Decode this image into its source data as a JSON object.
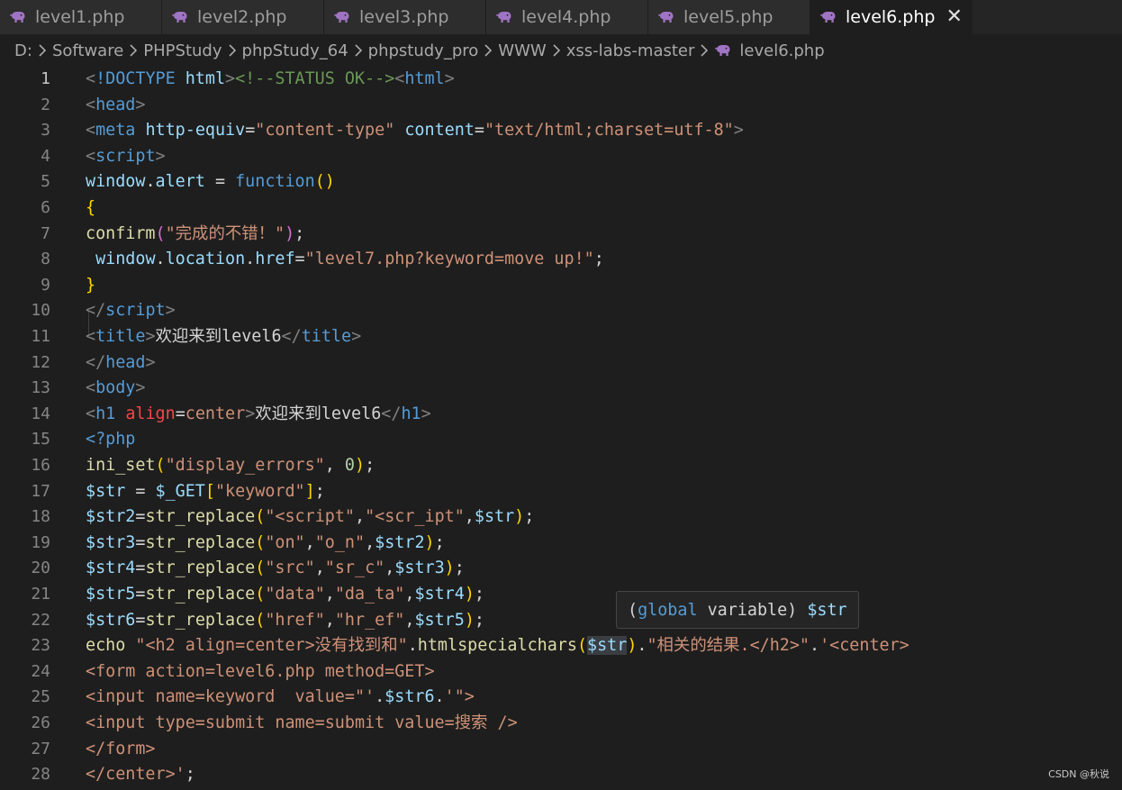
{
  "tabs": [
    {
      "label": "level1.php",
      "active": false
    },
    {
      "label": "level2.php",
      "active": false
    },
    {
      "label": "level3.php",
      "active": false
    },
    {
      "label": "level4.php",
      "active": false
    },
    {
      "label": "level5.php",
      "active": false
    },
    {
      "label": "level6.php",
      "active": true
    }
  ],
  "breadcrumb": {
    "parts": [
      "D:",
      "Software",
      "PHPStudy",
      "phpStudy_64",
      "phpstudy_pro",
      "WWW",
      "xss-labs-master"
    ],
    "file": "level6.php"
  },
  "editor": {
    "current_line": 1,
    "lines": [
      {
        "n": "1",
        "tokens": [
          [
            "t-punc",
            "<"
          ],
          [
            "t-tag",
            "!DOCTYPE"
          ],
          [
            "t-plain",
            " "
          ],
          [
            "t-attr",
            "html"
          ],
          [
            "t-punc",
            ">"
          ],
          [
            "t-cmt",
            "<!--STATUS OK-->"
          ],
          [
            "t-punc",
            "<"
          ],
          [
            "t-tag",
            "html"
          ],
          [
            "t-punc",
            ">"
          ]
        ]
      },
      {
        "n": "2",
        "tokens": [
          [
            "t-punc",
            "<"
          ],
          [
            "t-tag",
            "head"
          ],
          [
            "t-punc",
            ">"
          ]
        ]
      },
      {
        "n": "3",
        "tokens": [
          [
            "t-punc",
            "<"
          ],
          [
            "t-tag",
            "meta"
          ],
          [
            "t-plain",
            " "
          ],
          [
            "t-attr",
            "http-equiv"
          ],
          [
            "t-plain",
            "="
          ],
          [
            "t-str",
            "\"content-type\""
          ],
          [
            "t-plain",
            " "
          ],
          [
            "t-attr",
            "content"
          ],
          [
            "t-plain",
            "="
          ],
          [
            "t-str",
            "\"text/html;charset=utf-8\""
          ],
          [
            "t-punc",
            ">"
          ]
        ]
      },
      {
        "n": "4",
        "tokens": [
          [
            "t-punc",
            "<"
          ],
          [
            "t-tag",
            "script"
          ],
          [
            "t-punc",
            ">"
          ]
        ]
      },
      {
        "n": "5",
        "tokens": [
          [
            "t-var",
            "window"
          ],
          [
            "t-plain",
            "."
          ],
          [
            "t-var",
            "alert"
          ],
          [
            "t-plain",
            " = "
          ],
          [
            "t-kw",
            "function"
          ],
          [
            "t-br1",
            "()"
          ]
        ]
      },
      {
        "n": "6",
        "tokens": [
          [
            "t-br1",
            "{"
          ]
        ]
      },
      {
        "n": "7",
        "tokens": [
          [
            "t-fn",
            "confirm"
          ],
          [
            "t-br2",
            "("
          ],
          [
            "t-str",
            "\"完成的不错！\""
          ],
          [
            "t-br2",
            ")"
          ],
          [
            "t-plain",
            ";"
          ]
        ]
      },
      {
        "n": "8",
        "tokens": [
          [
            "t-plain",
            " "
          ],
          [
            "t-var",
            "window"
          ],
          [
            "t-plain",
            "."
          ],
          [
            "t-var",
            "location"
          ],
          [
            "t-plain",
            "."
          ],
          [
            "t-var",
            "href"
          ],
          [
            "t-plain",
            "="
          ],
          [
            "t-str",
            "\"level7.php?keyword=move up!\""
          ],
          [
            "t-plain",
            ";"
          ]
        ]
      },
      {
        "n": "9",
        "tokens": [
          [
            "t-br1",
            "}"
          ]
        ]
      },
      {
        "n": "10",
        "tokens": [
          [
            "t-punc",
            "</"
          ],
          [
            "t-tag",
            "script"
          ],
          [
            "t-punc",
            ">"
          ]
        ]
      },
      {
        "n": "11",
        "tokens": [
          [
            "t-punc",
            "<"
          ],
          [
            "t-tag",
            "title"
          ],
          [
            "t-punc",
            ">"
          ],
          [
            "t-plain",
            "欢迎来到level6"
          ],
          [
            "t-punc",
            "</"
          ],
          [
            "t-tag",
            "title"
          ],
          [
            "t-punc",
            ">"
          ]
        ]
      },
      {
        "n": "12",
        "tokens": [
          [
            "t-punc",
            "</"
          ],
          [
            "t-tag",
            "head"
          ],
          [
            "t-punc",
            ">"
          ]
        ]
      },
      {
        "n": "13",
        "tokens": [
          [
            "t-punc",
            "<"
          ],
          [
            "t-tag",
            "body"
          ],
          [
            "t-punc",
            ">"
          ]
        ]
      },
      {
        "n": "14",
        "tokens": [
          [
            "t-punc",
            "<"
          ],
          [
            "t-tag",
            "h1"
          ],
          [
            "t-plain",
            " "
          ],
          [
            "t-err",
            "align"
          ],
          [
            "t-plain",
            "="
          ],
          [
            "t-str",
            "center"
          ],
          [
            "t-punc",
            ">"
          ],
          [
            "t-plain",
            "欢迎来到level6"
          ],
          [
            "t-punc",
            "</"
          ],
          [
            "t-tag",
            "h1"
          ],
          [
            "t-punc",
            ">"
          ]
        ]
      },
      {
        "n": "15",
        "tokens": [
          [
            "t-tag",
            "<?php"
          ]
        ]
      },
      {
        "n": "16",
        "tokens": [
          [
            "t-fn",
            "ini_set"
          ],
          [
            "t-br1",
            "("
          ],
          [
            "t-str",
            "\"display_errors\""
          ],
          [
            "t-plain",
            ", "
          ],
          [
            "t-num",
            "0"
          ],
          [
            "t-br1",
            ")"
          ],
          [
            "t-plain",
            ";"
          ]
        ]
      },
      {
        "n": "17",
        "tokens": [
          [
            "t-var",
            "$str"
          ],
          [
            "t-plain",
            " = "
          ],
          [
            "t-var",
            "$_GET"
          ],
          [
            "t-br1",
            "["
          ],
          [
            "t-str",
            "\"keyword\""
          ],
          [
            "t-br1",
            "]"
          ],
          [
            "t-plain",
            ";"
          ]
        ]
      },
      {
        "n": "18",
        "tokens": [
          [
            "t-var",
            "$str2"
          ],
          [
            "t-plain",
            "="
          ],
          [
            "t-fn",
            "str_replace"
          ],
          [
            "t-br1",
            "("
          ],
          [
            "t-str",
            "\"<script\""
          ],
          [
            "t-plain",
            ","
          ],
          [
            "t-str",
            "\"<scr_ipt\""
          ],
          [
            "t-plain",
            ","
          ],
          [
            "t-var",
            "$str"
          ],
          [
            "t-br1",
            ")"
          ],
          [
            "t-plain",
            ";"
          ]
        ]
      },
      {
        "n": "19",
        "tokens": [
          [
            "t-var",
            "$str3"
          ],
          [
            "t-plain",
            "="
          ],
          [
            "t-fn",
            "str_replace"
          ],
          [
            "t-br1",
            "("
          ],
          [
            "t-str",
            "\"on\""
          ],
          [
            "t-plain",
            ","
          ],
          [
            "t-str",
            "\"o_n\""
          ],
          [
            "t-plain",
            ","
          ],
          [
            "t-var",
            "$str2"
          ],
          [
            "t-br1",
            ")"
          ],
          [
            "t-plain",
            ";"
          ]
        ]
      },
      {
        "n": "20",
        "tokens": [
          [
            "t-var",
            "$str4"
          ],
          [
            "t-plain",
            "="
          ],
          [
            "t-fn",
            "str_replace"
          ],
          [
            "t-br1",
            "("
          ],
          [
            "t-str",
            "\"src\""
          ],
          [
            "t-plain",
            ","
          ],
          [
            "t-str",
            "\"sr_c\""
          ],
          [
            "t-plain",
            ","
          ],
          [
            "t-var",
            "$str3"
          ],
          [
            "t-br1",
            ")"
          ],
          [
            "t-plain",
            ";"
          ]
        ]
      },
      {
        "n": "21",
        "tokens": [
          [
            "t-var",
            "$str5"
          ],
          [
            "t-plain",
            "="
          ],
          [
            "t-fn",
            "str_replace"
          ],
          [
            "t-br1",
            "("
          ],
          [
            "t-str",
            "\"data\""
          ],
          [
            "t-plain",
            ","
          ],
          [
            "t-str",
            "\"da_ta\""
          ],
          [
            "t-plain",
            ","
          ],
          [
            "t-var",
            "$str4"
          ],
          [
            "t-br1",
            ")"
          ],
          [
            "t-plain",
            ";"
          ]
        ]
      },
      {
        "n": "22",
        "tokens": [
          [
            "t-var",
            "$str6"
          ],
          [
            "t-plain",
            "="
          ],
          [
            "t-fn",
            "str_replace"
          ],
          [
            "t-br1",
            "("
          ],
          [
            "t-str",
            "\"href\""
          ],
          [
            "t-plain",
            ","
          ],
          [
            "t-str",
            "\"hr_ef\""
          ],
          [
            "t-plain",
            ","
          ],
          [
            "t-var",
            "$str5"
          ],
          [
            "t-br1",
            ")"
          ],
          [
            "t-plain",
            ";"
          ]
        ]
      },
      {
        "n": "23",
        "tokens": [
          [
            "t-fn",
            "echo"
          ],
          [
            "t-plain",
            " "
          ],
          [
            "t-str",
            "\"<h2 align=center>没有找到和\""
          ],
          [
            "t-plain",
            "."
          ],
          [
            "t-fn",
            "htmlspecialchars"
          ],
          [
            "t-br1",
            "("
          ],
          [
            "t-var word-hl",
            "$str"
          ],
          [
            "t-br1",
            ")"
          ],
          [
            "t-plain",
            "."
          ],
          [
            "t-str",
            "\"相关的结果.</h2>\""
          ],
          [
            "t-plain",
            "."
          ],
          [
            "t-str",
            "'<center>"
          ]
        ]
      },
      {
        "n": "24",
        "tokens": [
          [
            "t-str",
            "<form action=level6.php method=GET>"
          ]
        ]
      },
      {
        "n": "25",
        "tokens": [
          [
            "t-str",
            "<input name=keyword  value=\"'"
          ],
          [
            "t-plain",
            "."
          ],
          [
            "t-var",
            "$str6"
          ],
          [
            "t-plain",
            "."
          ],
          [
            "t-str",
            "'\">"
          ]
        ]
      },
      {
        "n": "26",
        "tokens": [
          [
            "t-str",
            "<input type=submit name=submit value=搜索 />"
          ]
        ]
      },
      {
        "n": "27",
        "tokens": [
          [
            "t-str",
            "</form>"
          ]
        ]
      },
      {
        "n": "28",
        "tokens": [
          [
            "t-str",
            "</center>'"
          ],
          [
            "t-plain",
            ";"
          ]
        ]
      }
    ]
  },
  "hover": {
    "tokens": [
      [
        "t-plain",
        "("
      ],
      [
        "t-kw",
        "global"
      ],
      [
        "t-plain",
        " variable) "
      ],
      [
        "t-var",
        "$str"
      ]
    ]
  },
  "watermark": "CSDN @秋说",
  "colors": {
    "background": "#1e1e1e",
    "tab_inactive": "#2d2d2d",
    "php_icon": "#a074c4"
  }
}
